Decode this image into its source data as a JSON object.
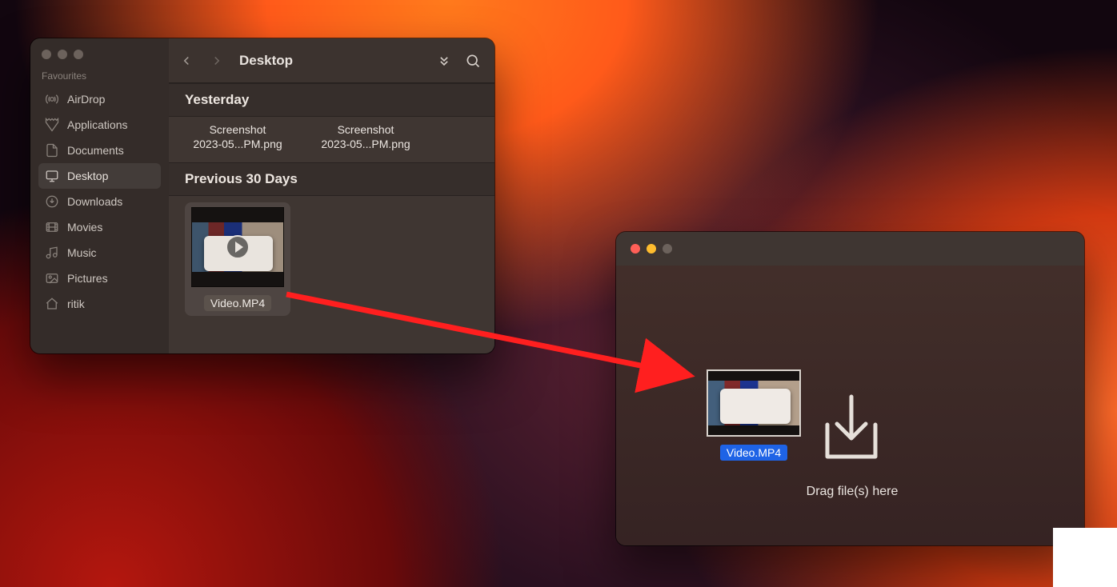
{
  "toolbar": {
    "title": "Desktop"
  },
  "sidebar": {
    "section": "Favourites",
    "items": [
      {
        "label": "AirDrop",
        "icon": "airdrop-icon",
        "selected": false
      },
      {
        "label": "Applications",
        "icon": "applications-icon",
        "selected": false
      },
      {
        "label": "Documents",
        "icon": "documents-icon",
        "selected": false
      },
      {
        "label": "Desktop",
        "icon": "desktop-icon",
        "selected": true
      },
      {
        "label": "Downloads",
        "icon": "downloads-icon",
        "selected": false
      },
      {
        "label": "Movies",
        "icon": "movies-icon",
        "selected": false
      },
      {
        "label": "Music",
        "icon": "music-icon",
        "selected": false
      },
      {
        "label": "Pictures",
        "icon": "pictures-icon",
        "selected": false
      },
      {
        "label": "ritik",
        "icon": "home-icon",
        "selected": false
      }
    ]
  },
  "groups": [
    {
      "header": "Yesterday",
      "files": [
        {
          "name_line1": "Screenshot",
          "name_line2": "2023-05...PM.png"
        },
        {
          "name_line1": "Screenshot",
          "name_line2": "2023-05...PM.png"
        }
      ]
    },
    {
      "header": "Previous 30 Days",
      "files": [
        {
          "name": "Video.MP4",
          "selected": true
        }
      ]
    }
  ],
  "drop_window": {
    "dragged_file": "Video.MP4",
    "hint": "Drag file(s) here"
  }
}
